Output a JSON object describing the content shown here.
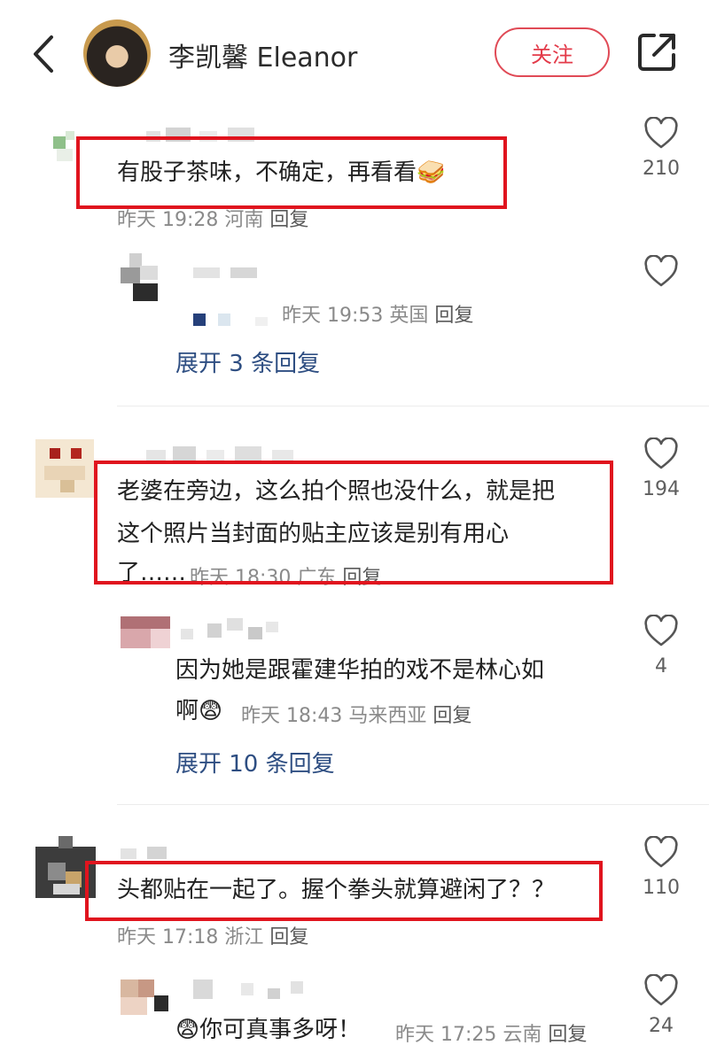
{
  "header": {
    "username": "李凯馨 Eleanor",
    "follow_label": "关注"
  },
  "comments": [
    {
      "text": "有股子茶味，不确定，再看看🥪",
      "time": "昨天 19:28",
      "location": "河南",
      "reply_label": "回复",
      "likes": "210",
      "sub": {
        "time": "昨天 19:53",
        "location": "英国",
        "reply_label": "回复"
      },
      "expand_label": "展开 3 条回复"
    },
    {
      "text_lines": [
        "老婆在旁边，这么拍个照也没什么，就是把",
        "这个照片当封面的贴主应该是别有用心",
        "了……"
      ],
      "time": "昨天 18:30",
      "location": "广东",
      "reply_label": "回复",
      "likes": "194",
      "sub": {
        "text_lines": [
          "因为她是跟霍建华拍的戏不是林心如",
          "啊😨"
        ],
        "time": "昨天 18:43",
        "location": "马来西亚",
        "reply_label": "回复",
        "likes": "4"
      },
      "expand_label": "展开 10 条回复"
    },
    {
      "text": "头都贴在一起了。握个拳头就算避闲了？？",
      "time": "昨天 17:18",
      "location": "浙江",
      "reply_label": "回复",
      "likes": "110",
      "sub": {
        "text": "😨你可真事多呀！",
        "time": "昨天 17:25",
        "location": "云南",
        "reply_label": "回复",
        "likes": "24"
      }
    }
  ],
  "icons": {
    "back": "chevron-left-icon",
    "share": "share-icon",
    "like": "heart-outline-icon"
  },
  "colors": {
    "accent": "#e33a49",
    "link": "#2e4e82",
    "highlight_box": "#e0141e"
  }
}
